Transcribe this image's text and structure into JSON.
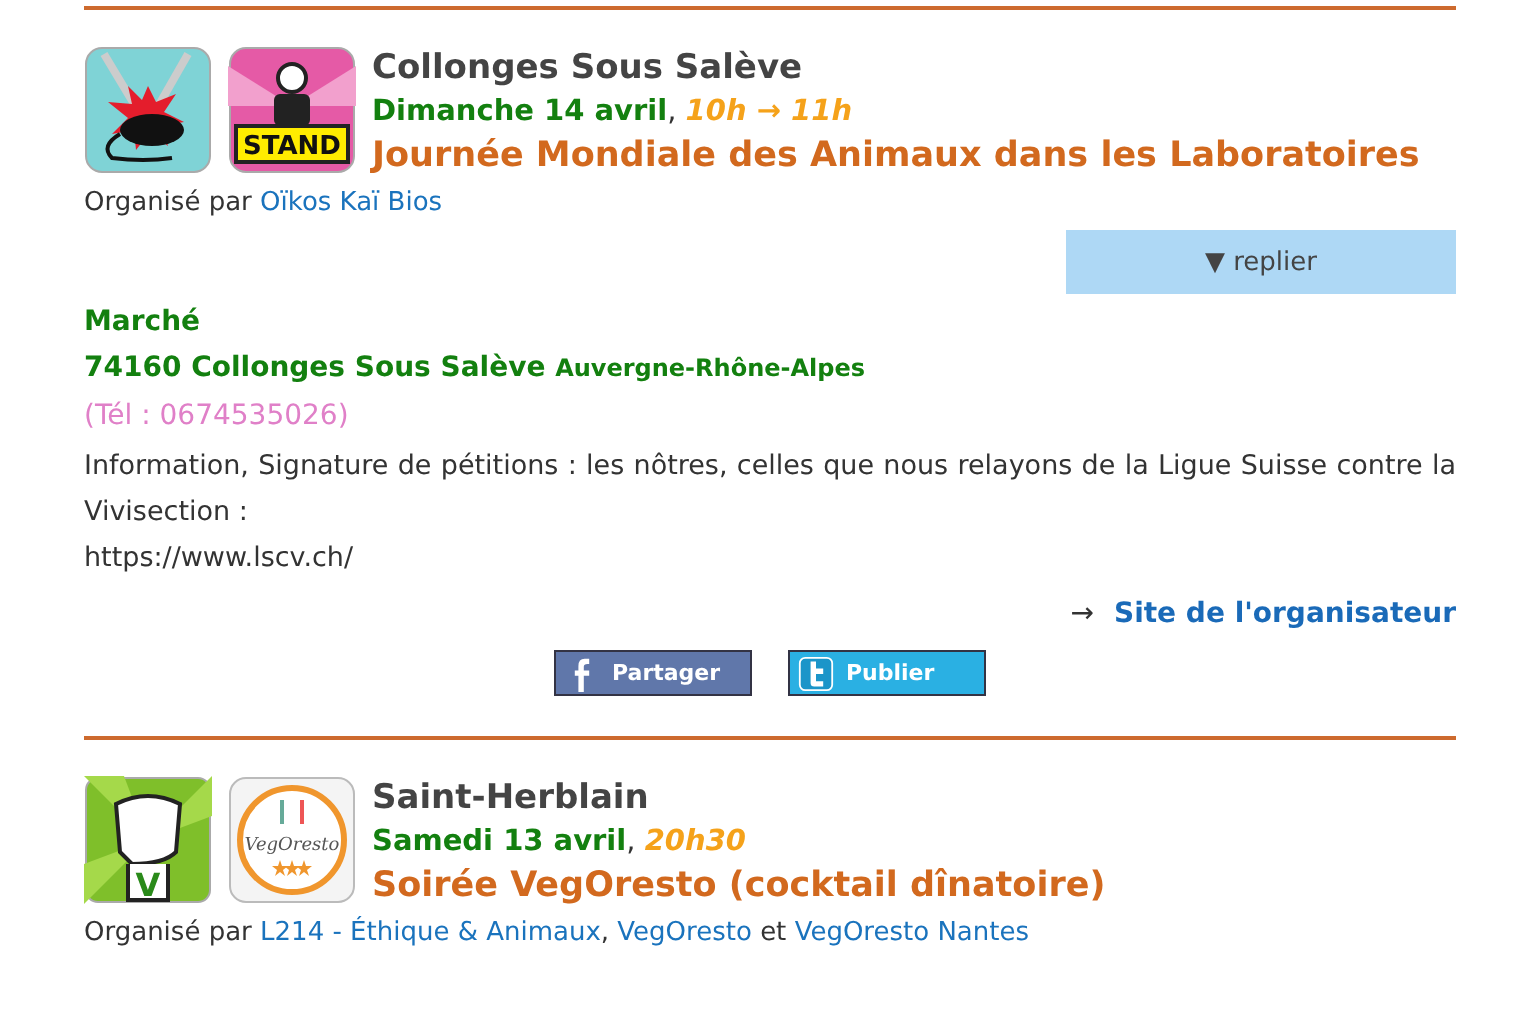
{
  "events": [
    {
      "icons": [
        {
          "kind": "lab"
        },
        {
          "kind": "stand",
          "label": "STAND"
        }
      ],
      "place": "Collonges Sous Salève",
      "date": "Dimanche 14 avril",
      "date_separator": ",",
      "time": "10h → 11h",
      "title": "Journée Mondiale des Animaux dans les Laboratoires",
      "organizers": [
        {
          "kind": "plain",
          "text": "Organisé par"
        },
        {
          "kind": "link",
          "text": "Oïkos Kaï Bios"
        }
      ],
      "expanded": true,
      "toggle": "▼ replier",
      "venue": "Marché",
      "address": "74160 Collonges Sous Salève",
      "region": "Auvergne-Rhône-Alpes",
      "phone": "(Tél : 0674535026)",
      "description": [
        "Information, Signature de pétitions : les nôtres, celles que nous relayons de la Ligue Suisse contre la Vivisection :",
        "https://www.lscv.ch/"
      ],
      "site_arrow": "→",
      "site_link": "Site de l'organisateur",
      "share": [
        {
          "kind": "facebook",
          "label": "Partager"
        },
        {
          "kind": "twitter",
          "label": "Publier"
        }
      ]
    },
    {
      "icons": [
        {
          "kind": "fist",
          "label": "V"
        },
        {
          "kind": "vegoresto",
          "label": "VegOresto"
        }
      ],
      "place": "Saint-Herblain",
      "date": "Samedi 13 avril",
      "date_separator": ",",
      "time": "20h30",
      "title": "Soirée VegOresto (cocktail dînatoire)",
      "organizers": [
        {
          "kind": "plain",
          "text": "Organisé par"
        },
        {
          "kind": "link",
          "text": "L214 - Éthique & Animaux"
        },
        {
          "kind": "plain",
          "text": ", "
        },
        {
          "kind": "link",
          "text": "VegOresto"
        },
        {
          "kind": "plain",
          "text": "et"
        },
        {
          "kind": "link",
          "text": "VegOresto Nantes"
        }
      ],
      "expanded": false
    }
  ]
}
